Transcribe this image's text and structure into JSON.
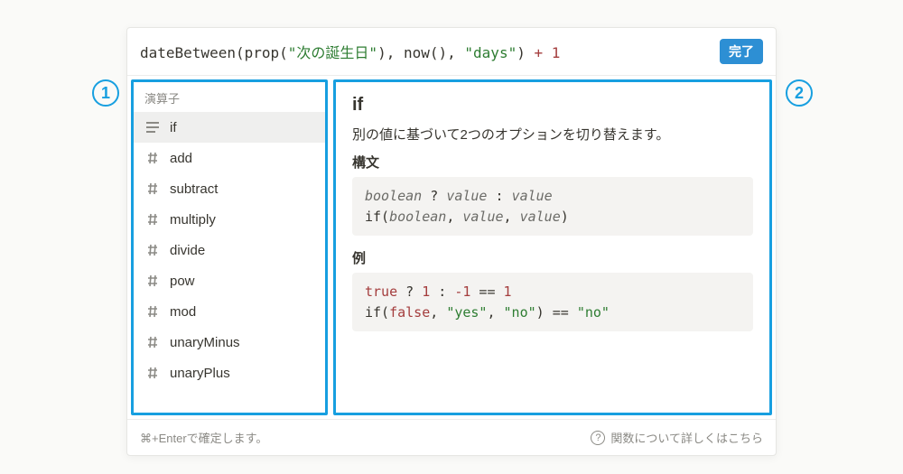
{
  "formula": {
    "fn1": "dateBetween",
    "fn2": "prop",
    "arg1": "\"次の誕生日\"",
    "fn3": "now",
    "arg2": "\"days\"",
    "op": "+",
    "num": "1"
  },
  "done_label": "完了",
  "left": {
    "header": "演算子",
    "items": [
      {
        "label": "if",
        "icon": "lines",
        "selected": true
      },
      {
        "label": "add",
        "icon": "hash"
      },
      {
        "label": "subtract",
        "icon": "hash"
      },
      {
        "label": "multiply",
        "icon": "hash"
      },
      {
        "label": "divide",
        "icon": "hash"
      },
      {
        "label": "pow",
        "icon": "hash"
      },
      {
        "label": "mod",
        "icon": "hash"
      },
      {
        "label": "unaryMinus",
        "icon": "hash"
      },
      {
        "label": "unaryPlus",
        "icon": "hash"
      }
    ]
  },
  "detail": {
    "title": "if",
    "desc": "別の値に基づいて2つのオプションを切り替えます。",
    "syntax_label": "構文",
    "example_label": "例"
  },
  "footer": {
    "hint": "⌘+Enterで確定します。",
    "help": "関数について詳しくはこちら"
  },
  "annotations": {
    "one": "1",
    "two": "2"
  }
}
